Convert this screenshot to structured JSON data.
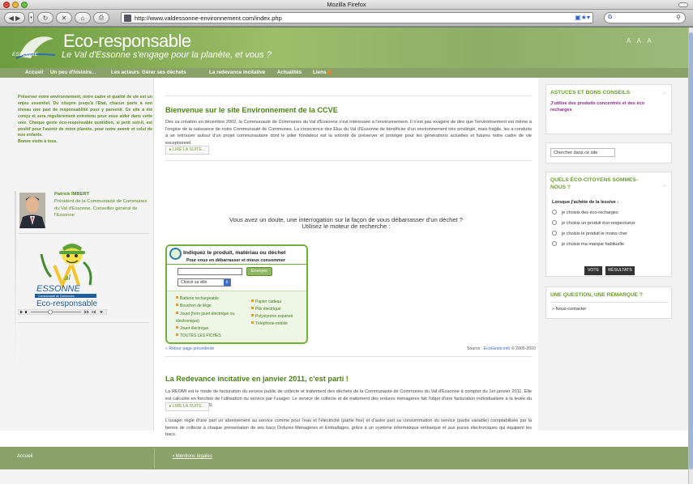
{
  "browser": {
    "window_title": "Mozilla Firefox",
    "url": "http://www.valdessonne-environnement.com/index.php",
    "search_engine": "G",
    "buttons": [
      "back-icon",
      "forward-icon",
      "reload-icon",
      "stop-icon",
      "home-icon",
      "print-icon"
    ]
  },
  "banner": {
    "logo_word": "ESSONNE",
    "title": "Eco-responsable",
    "tagline": "Le Val d'Essonne s'engage pour la planète, et vous ?",
    "text_size_controls": "A A A"
  },
  "nav": {
    "items": [
      "Accueil",
      "Un peu d'histoire...",
      "Les acteurs",
      "Gérer ses déchets",
      "La redevance incitative",
      "Actualités",
      "Liens"
    ]
  },
  "left": {
    "intro": "Préserver notre environnement, notre cadre et qualité de vie est un enjeu essentiel. Du citoyen jusqu'à l'Etat, chacun porte à son niveau une part de responsabilité pour y parvenir. Ce site a été conçu et sera régulièrement entretenu pour vous aider dans cette voie. Chaque geste éco-responsable quotidien, si petit soit-il, est positif pour l'avenir de notre planète, pour notre avenir et celui de nos enfants.",
    "intro_sign": "Bonne visite à tous.",
    "mayor_name": "Patrick IMBERT",
    "mayor_role": "Président de la Communauté de Communes du Val d'Essonne, Conseiller général de l'Essonne",
    "logo_text": "ESSONNE",
    "logo_banner": "Communauté de Communes",
    "logo_sub": "Eco-responsable"
  },
  "main": {
    "welcome_title": "Bienvenue sur le site Environnement de la CCVE",
    "welcome_text": "Dès sa création en décembre 2002, la Communauté de Communes du Val d'Essonne s'est intéressée à l'environnement. Il n'est pas exagéré de dire que l'environnement est même à l'origine de la naissance de notre Communauté de Communes. La conscience des Elus du Val d'Essonne de bénéficier d'un environnement très privilégié, mais fragile, les a conduits à se retrouver autour d'un projet communautaire dont le pilier fondateur est la volonté de préserver et protéger pour les générations actuelles et futures notre cadre de vie exceptionnel.",
    "readmore": "LIRE LA SUITE...",
    "question_line1": "Vous avez un doute, une interrogation sur la façon de vous débarrasser d'un déchet ?",
    "question_line2": "Utilisez le moteur de recherche :",
    "widget": {
      "title": "Indiquez le produit, matériau ou déchet",
      "subtitle": "Pour vous en débarrasser et mieux consommer",
      "send": "Envoyer",
      "select": "Choisir sa ville",
      "col1": [
        "Batterie rechargeable",
        "Bouchon de liège",
        "Jouet (hors jouet électrique ou électronique)",
        "Jouet électrique",
        "TOUTES LES FICHES"
      ],
      "col2": [
        "Papier cadeau",
        "Pile électrique",
        "Polystyrène expansé",
        "Téléphone mobile"
      ]
    },
    "back_link": "« Retour page précédente",
    "source_label": "Source :",
    "source_name": "EcoGeste.info",
    "source_year": "© 2005-2010",
    "redevance_title": "La Redevance incitative en janvier 2011, c'est parti !",
    "redevance_p1": "La REOMI est le mode de facturation du service public de collecte et traitement des déchets de la Communauté de Communes du Val d'Essonne à compter du 1er janvier 2011. Elle est calculée en fonction de l'utilisation du service par l'usager. Le service de collecte et de traitement des ordures ménagères fait l'objet d'une facturation individualisée à la levée du bac et NON AU POIDS.",
    "redevance_p2": "L'usager règle d'une part un abonnement au service comme pour l'eau et l'électricité (partie fixe) et d'autre part sa consommation du service (partie variable) comptabilisée par la benne de collecte à chaque présentation de ses bacs Ordures Ménagères et Emballages, grâce à un système informatique embarqué et aux puces électroniques qui équipent les bacs.",
    "readmore2": "LIRE LA SUITE..."
  },
  "right": {
    "tips_title": "ASTUCES ET BONS CONSEILS",
    "tips_link": "J'utilise des produits concentrés et des éco recharges",
    "search_placeholder": "Chercher dans ce site",
    "poll_title": "QUELS ÉCO-CITOYENS SOMMES-NOUS ?",
    "poll_question": "Lorsque j'achète de la lessive :",
    "poll_options": [
      "je choisis des éco-recharges",
      "je choisis un produit éco-respectueux",
      "je choisis le produit le moins cher",
      "je choisis ma marque habituelle"
    ],
    "vote": "VOTE",
    "results": "RÉSULTATS",
    "contact_title": "UNE QUESTION, UNE REMARQUE ?",
    "contact_link": "Nous contacter"
  },
  "footer": {
    "home": "Accueil",
    "legal": "Mentions légales"
  },
  "colors": {
    "brand_green": "#8aa26a",
    "title_green": "#4c8216",
    "link_purple": "#8a2a8e"
  }
}
